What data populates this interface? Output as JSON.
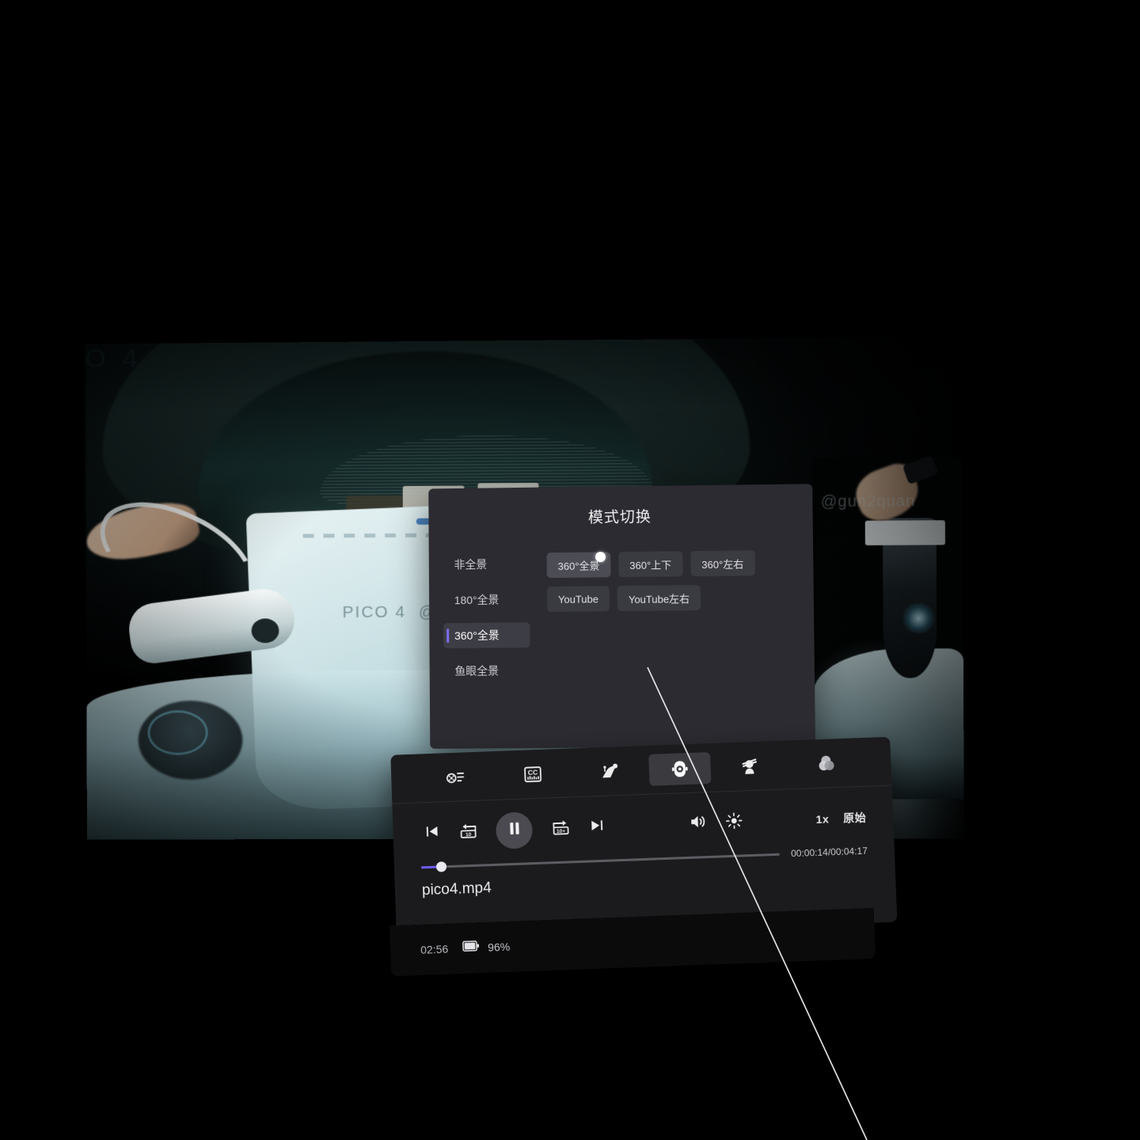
{
  "app": {
    "name": "pico-vr-video-player",
    "accent_color": "#6c5cf0",
    "panel_color": "#2b2b31",
    "player_color": "#1b1b1d"
  },
  "video": {
    "watermark_left": "PICO 4",
    "watermark_handle_left": "@gun2quan",
    "watermark_handle_right": "@gun2quan"
  },
  "mode_dialog": {
    "title": "模式切换",
    "sidebar": [
      {
        "label": "非全景",
        "selected": false
      },
      {
        "label": "180°全景",
        "selected": false
      },
      {
        "label": "360°全景",
        "selected": true
      },
      {
        "label": "鱼眼全景",
        "selected": false
      }
    ],
    "options_row1": [
      {
        "label": "360°全景",
        "hovered": true
      },
      {
        "label": "360°上下",
        "hovered": false
      },
      {
        "label": "360°左右",
        "hovered": false
      }
    ],
    "options_row2": [
      {
        "label": "YouTube",
        "hovered": false
      },
      {
        "label": "YouTube左右",
        "hovered": false
      }
    ]
  },
  "player": {
    "tools": [
      {
        "name": "playlist-icon",
        "label": "播放列表",
        "active": false
      },
      {
        "name": "subtitle-cc-icon",
        "label": "字幕",
        "active": false
      },
      {
        "name": "screen-mode-icon",
        "label": "屏幕",
        "active": false
      },
      {
        "name": "panorama-360-icon",
        "label": "模式切换",
        "active": true
      },
      {
        "name": "vr-headset-icon",
        "label": "3D",
        "active": false
      },
      {
        "name": "color-filter-icon",
        "label": "画质",
        "active": false
      }
    ],
    "controls": [
      {
        "name": "previous-button",
        "label": "上一个"
      },
      {
        "name": "rewind-10-button",
        "label": "-10"
      },
      {
        "name": "pause-button",
        "label": "暂停"
      },
      {
        "name": "forward-10-button",
        "label": "10+"
      },
      {
        "name": "next-button",
        "label": "下一个"
      }
    ],
    "volume_label": "音量",
    "brightness_label": "亮度",
    "speed_label": "1x",
    "quality_label": "原始",
    "seek": {
      "progress_percent": 5.5,
      "time_display": "00:00:14/00:04:17",
      "current": "00:00:14",
      "total": "00:04:17"
    },
    "filename": "pico4.mp4"
  },
  "status_bar": {
    "clock": "02:56",
    "battery_percent": "96%",
    "battery_level": 96
  }
}
